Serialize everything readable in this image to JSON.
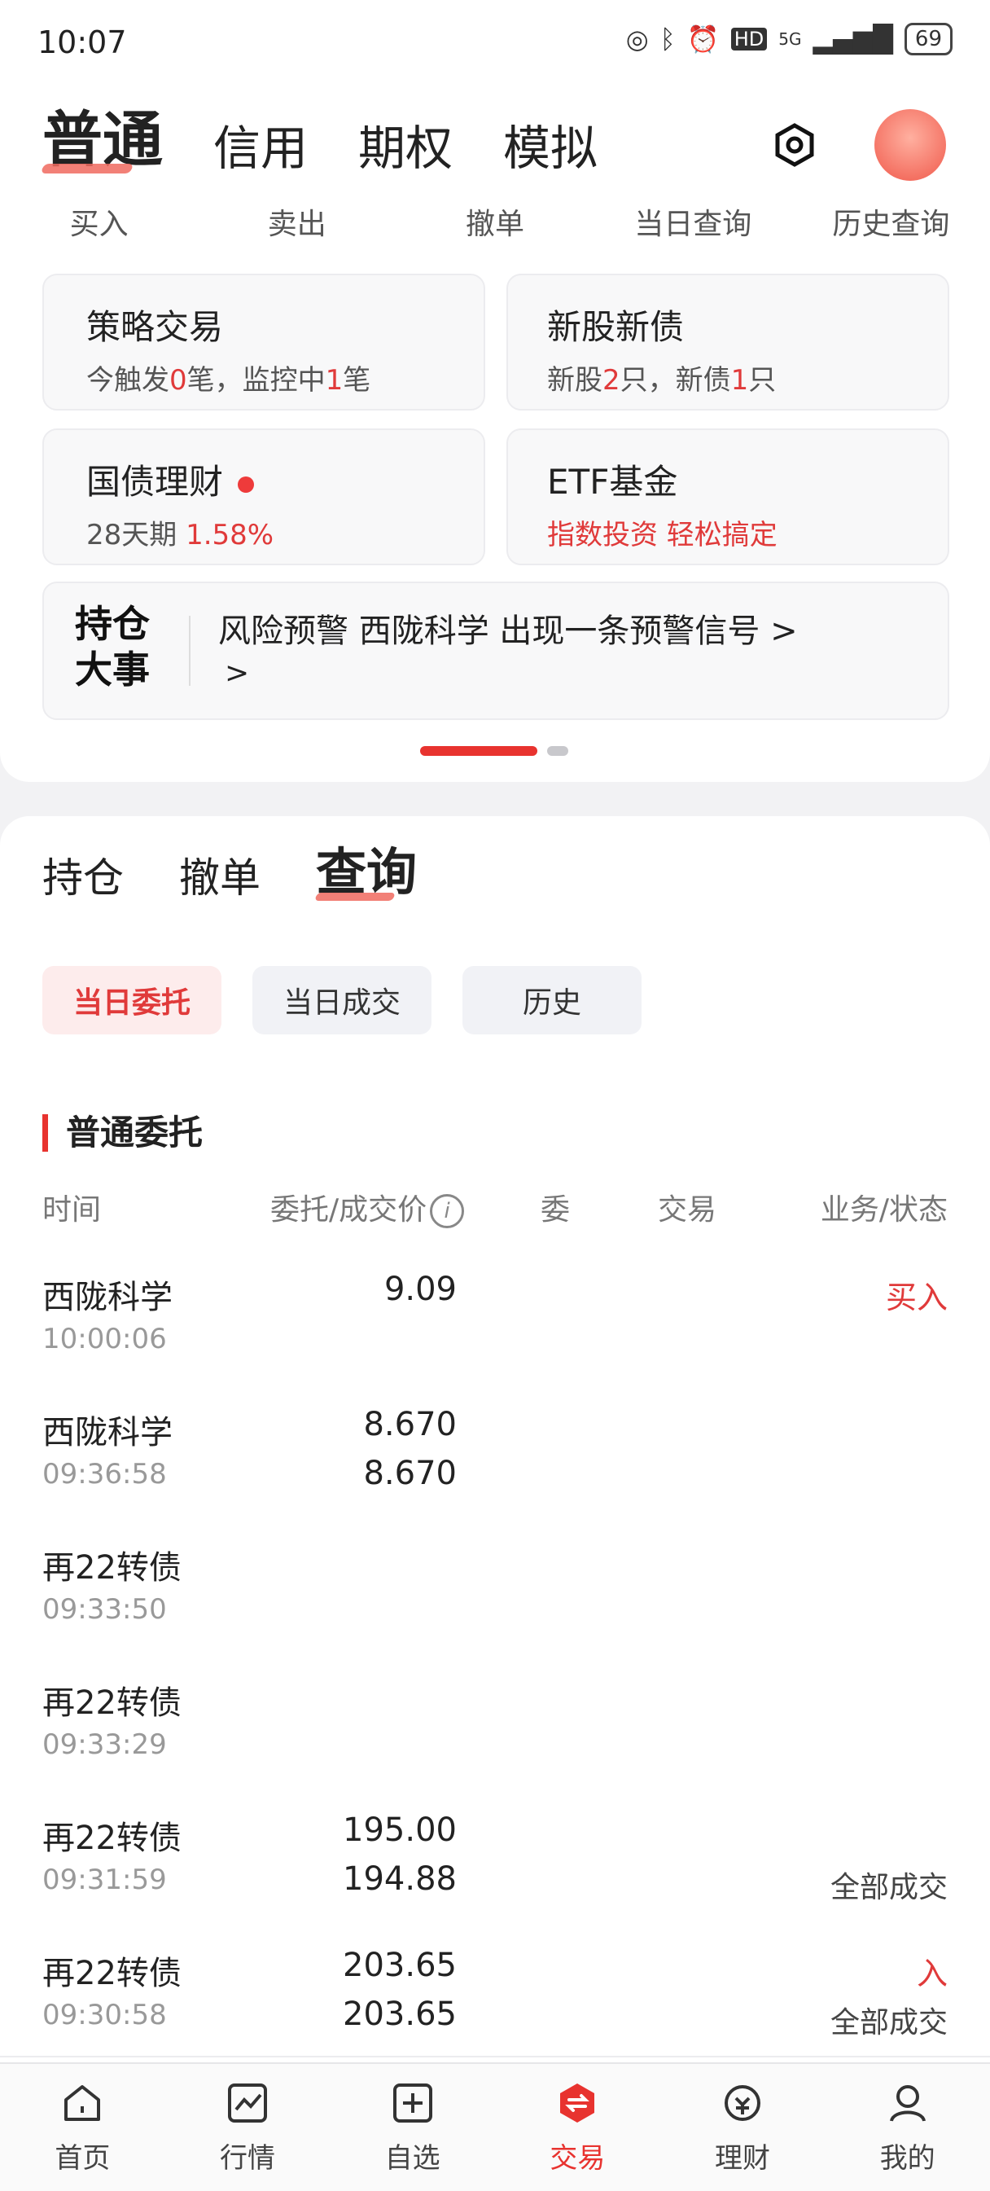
{
  "status_bar": {
    "time": "10:07",
    "network": "5G",
    "hd": "HD",
    "battery": "69"
  },
  "main_tabs": [
    "普通",
    "信用",
    "期权",
    "模拟"
  ],
  "actions": [
    "买入",
    "卖出",
    "撤单",
    "当日查询",
    "历史查询"
  ],
  "cards": {
    "strategy": {
      "title": "策略交易",
      "sub_prefix": "今触发",
      "triggered": "0",
      "sub_mid": "笔，监控中",
      "monitoring": "1",
      "sub_suffix": "笔"
    },
    "ipo": {
      "title": "新股新债",
      "sub_prefix": "新股",
      "stocks": "2",
      "sub_mid": "只，新债",
      "bonds": "1",
      "sub_suffix": "只"
    },
    "bond_finance": {
      "title": "国债理财",
      "term": "28天期",
      "rate": "1.58%"
    },
    "etf": {
      "title": "ETF基金",
      "sub": "指数投资 轻松搞定"
    },
    "alert": {
      "badge_line1": "持仓",
      "badge_line2": "大事",
      "text": "风险预警 西陇科学 出现一条预警信号 >",
      "more": ">"
    }
  },
  "sub_tabs": [
    "持仓",
    "撤单",
    "查询"
  ],
  "chips": [
    "当日委托",
    "当日成交",
    "历史"
  ],
  "section_title": "普通委托",
  "table_headers": {
    "time": "时间",
    "price": "委托/成交价",
    "qty": "委",
    "trade": "交易",
    "status": "业务/状态"
  },
  "rows": [
    {
      "name": "西陇科学",
      "time": "10:00:06",
      "p1": "9.09",
      "p2": "",
      "op": "买入",
      "status": ""
    },
    {
      "name": "西陇科学",
      "time": "09:36:58",
      "p1": "8.670",
      "p2": "8.670",
      "op": "",
      "status": ""
    },
    {
      "name": "再22转债",
      "time": "09:33:50",
      "p1": "",
      "p2": "",
      "op": "",
      "status": ""
    },
    {
      "name": "再22转债",
      "time": "09:33:29",
      "p1": "",
      "p2": "",
      "op": "",
      "status": ""
    },
    {
      "name": "再22转债",
      "time": "09:31:59",
      "p1": "195.00",
      "p2": "194.88",
      "op": "",
      "status": "全部成交"
    },
    {
      "name": "再22转债",
      "time": "09:30:58",
      "p1": "203.65",
      "p2": "203.65",
      "op": "入",
      "status": "全部成交"
    }
  ],
  "bottom_nav": [
    "首页",
    "行情",
    "自选",
    "交易",
    "理财",
    "我的"
  ],
  "colors": {
    "accent": "#e8332f"
  }
}
